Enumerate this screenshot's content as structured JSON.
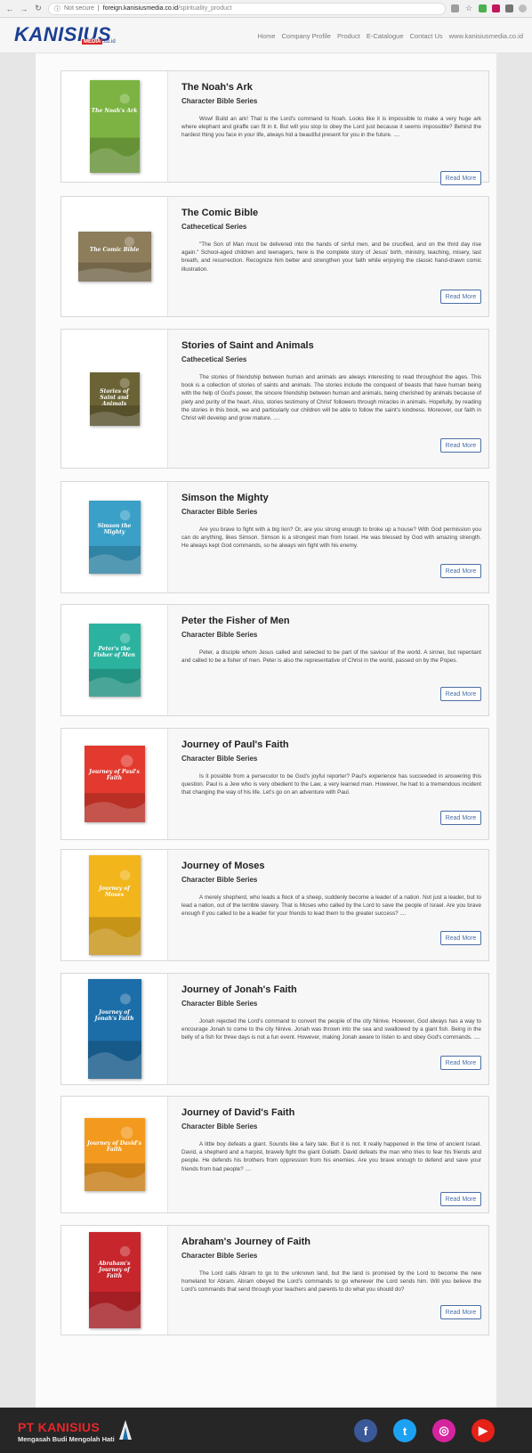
{
  "browser": {
    "security": "Not secure",
    "domain": "foreign.kanisiusmedia.co.id",
    "path": "/spirituality_product"
  },
  "header": {
    "logo_text": "KANISIUS",
    "logo_sub_media": "MEDIA",
    "logo_sub_domain": ".co.id",
    "nav": [
      "Home",
      "Company Profile",
      "Product",
      "E-Catalogue",
      "Contact Us",
      "www.kanisiusmedia.co.id"
    ]
  },
  "read_more_label": "Read More",
  "products": [
    {
      "title": "The Noah's Ark",
      "series": "Character Bible Series",
      "description": "Wow! Build an ark! That is the Lord's command to Noah. Looks like it is impossible to make a very huge ark where elephant and giraffe can fit in it. But will you stop to obey the Lord just because it seems impossible? Behind the hardest thing you face in your life, always hid a beautiful present for you in the future. ....",
      "cover_title": "The Noah's Ark",
      "cover_color": "#7cb342"
    },
    {
      "title": "The Comic Bible",
      "series": "Cathecetical Series",
      "description": "\"The Son of Man must be delivered into the hands of sinful men, and be crucified, and on the third day rise again.\" School-aged children and teenagers, here is the complete story of Jesus' birth, ministry, teaching, misery, last breath, and resurrection. Recognize him better and strengthen your faith while enjoying the classic hand-drawn comic illustration.",
      "cover_title": "The Comic Bible",
      "cover_color": "#8d7d5a"
    },
    {
      "title": "Stories of Saint and Animals",
      "series": "Cathecetical Series",
      "description": "The stories of friendship between human and animals are always interesting to read throughout the ages. This book is a collection of stories of saints and animals. The stories include the conquest of beasts that have human being with the help of God's power, the sincere friendship between human and animals, being cherished by animals because of piety and purity of the heart. Also, stories testimony of Christ' followers through miracles in animals. Hopefully, by reading the stories in this book, we and particularly our children will be able to follow the saint's kindness. Moreover, our faith in Christ will develop and grow mature. ....",
      "cover_title": "Stories of Saint and Animals",
      "cover_color": "#6b6335"
    },
    {
      "title": "Simson the Mighty",
      "series": "Character Bible Series",
      "description": "Are you brave to fight with a big lion? Or, are you strong enough to broke up a house? With God permission you can do anything, likes Simson. Simson is a strongest man from Israel. He was blessed by God with amazing strength. He always kept God commands, so he always win fight with his enemy.",
      "cover_title": "Simson the Mighty",
      "cover_color": "#3aa0c8"
    },
    {
      "title": "Peter the Fisher of Men",
      "series": "Character Bible Series",
      "description": "Peter, a disciple whom Jesus called and selected to be part of the saviour of the world. A sinner, but repentant and called to be a fisher of men. Peter is also the representative of Christ in the world, passed on by the Popes.",
      "cover_title": "Peter's the Fisher of Men",
      "cover_color": "#2bb3a0"
    },
    {
      "title": "Journey of Paul's Faith",
      "series": "Character Bible Series",
      "description": "Is it possible from a persecutor to be God's joyful reporter? Paul's experience has succeeded in answering this question. Paul is a Jew who is very obedient to the Law, a very learned man. However, he had to a tremendous incident that changing the way of his life. Let's go on an adventure with Paul.",
      "cover_title": "Journey of Paul's Faith",
      "cover_color": "#e23a2e"
    },
    {
      "title": "Journey of Moses",
      "series": "Character Bible Series",
      "description": "A merely shepherd, who leads a flock of a sheep, suddenly become a leader of a nation. Not just a leader, but to lead a nation, out of the terrible slavery. That is Moses who called by the Lord to save the people of Israel. Are you brave enough if you called to be a leader for your friends to lead them to the greater success? ....",
      "cover_title": "Journey of Moses",
      "cover_color": "#f2b51b"
    },
    {
      "title": "Journey of Jonah's Faith",
      "series": "Character Bible Series",
      "description": "Jonah rejected the Lord's command to convert the people of the city Ninive. However, God always has a way to encourage Jonah to come to the city Ninive. Jonah was thrown into the sea and swallowed by a giant fish. Being in the belly of a fish for three days is not a fun event. However, making Jonah aware to listen to and obey God's commands. ....",
      "cover_title": "Journey of Jonah's Faith",
      "cover_color": "#1c6ea8"
    },
    {
      "title": "Journey of David's Faith",
      "series": "Character Bible Series",
      "description": "A little boy defeats a giant. Sounds like a fairy tale. But it is not. It really happened in the time of ancient Israel. David, a shepherd and a harpist, bravely fight the giant Goliath. David defeats the man who tries to fear his friends and people. He defends his brothers from oppression from his enemies. Are you brave enough to defend and save your friends from bad people? ....",
      "cover_title": "Journey of David's Faith",
      "cover_color": "#f39a1e"
    },
    {
      "title": "Abraham's Journey of Faith",
      "series": "Character Bible Series",
      "description": "The Lord calls Abram to go to the unknown land, but the land is promised by the Lord to become the new homeland for Abram. Abram obeyed the Lord's commands to go wherever the Lord sends him. Will you believe the Lord's commands that send through your teachers and parents to do what you should do?",
      "cover_title": "Abraham's Journey of Faith",
      "cover_color": "#c7262c"
    }
  ],
  "footer": {
    "company": "PT KANISIUS",
    "tagline": "Mengasah Budi Mengolah Hati",
    "social": [
      {
        "icon": "facebook-icon",
        "glyph": "f",
        "color": "#3b5998"
      },
      {
        "icon": "twitter-icon",
        "glyph": "t",
        "color": "#1da1f2"
      },
      {
        "icon": "instagram-icon",
        "glyph": "◎",
        "color": "#d6249f"
      },
      {
        "icon": "youtube-icon",
        "glyph": "▶",
        "color": "#e62117"
      }
    ]
  }
}
